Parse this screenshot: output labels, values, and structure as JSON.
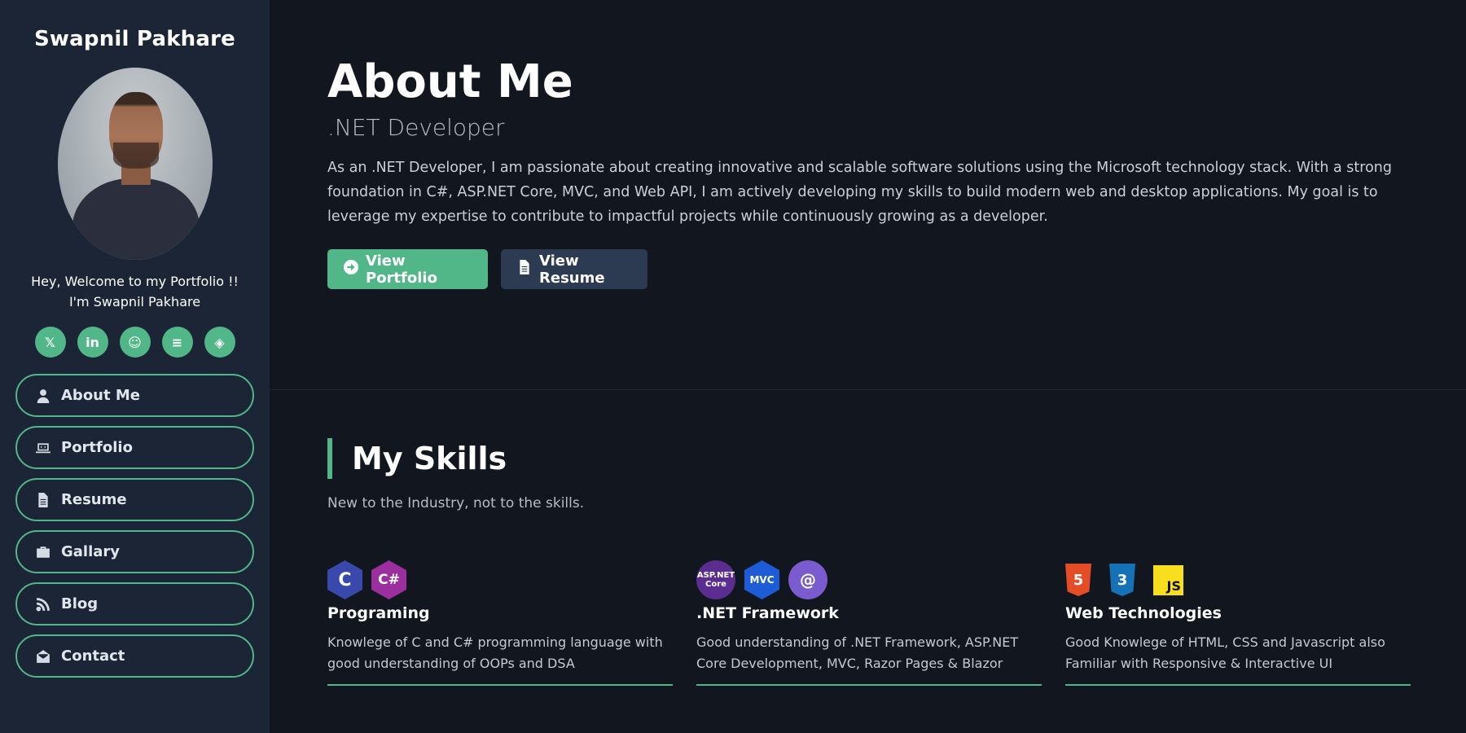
{
  "sidebar": {
    "name": "Swapnil Pakhare",
    "welcome_line1": "Hey, Welcome to my Portfolio !!",
    "welcome_line2": "I'm Swapnil Pakhare",
    "social": [
      {
        "icon": "x-twitter-icon",
        "glyph": "𝕏"
      },
      {
        "icon": "linkedin-icon",
        "glyph": "in"
      },
      {
        "icon": "github-icon",
        "glyph": "☺"
      },
      {
        "icon": "stack-overflow-icon",
        "glyph": "≡"
      },
      {
        "icon": "codepen-icon",
        "glyph": "◈"
      }
    ],
    "nav": [
      {
        "label": "About Me",
        "icon": "user-icon"
      },
      {
        "label": "Portfolio",
        "icon": "laptop-code-icon"
      },
      {
        "label": "Resume",
        "icon": "file-icon"
      },
      {
        "label": "Gallary",
        "icon": "briefcase-icon"
      },
      {
        "label": "Blog",
        "icon": "blog-icon"
      },
      {
        "label": "Contact",
        "icon": "envelope-open-icon"
      }
    ]
  },
  "about": {
    "title": "About Me",
    "subtitle": ".NET Developer",
    "description": "As an .NET Developer, I am passionate about creating innovative and scalable software solutions using the Microsoft technology stack. With a strong foundation in C#, ASP.NET Core, MVC, and Web API, I am actively developing my skills to build modern web and desktop applications. My goal is to leverage my expertise to contribute to impactful projects while continuously growing as a developer.",
    "buttons": {
      "portfolio": "View Portfolio",
      "resume": "View Resume"
    }
  },
  "skills": {
    "title": "My Skills",
    "subtitle": "New to the Industry, not to the skills.",
    "cards": [
      {
        "title": "Programing",
        "description": "Knowlege of C and C# programming language with good understanding of OOPs and DSA",
        "icons": [
          {
            "label": "C"
          },
          {
            "label": "C#"
          }
        ]
      },
      {
        "title": ".NET Framework",
        "description": "Good understanding of .NET Framework, ASP.NET Core Development, MVC, Razor Pages & Blazor",
        "icons": [
          {
            "label": "ASP.NET Core"
          },
          {
            "label": "MVC"
          },
          {
            "label": "@"
          }
        ]
      },
      {
        "title": "Web Technologies",
        "description": "Good Knowlege of HTML, CSS and Javascript also Familiar with Responsive & Interactive UI",
        "icons": [
          {
            "label": "5"
          },
          {
            "label": "3"
          },
          {
            "label": "JS"
          }
        ]
      }
    ]
  },
  "colors": {
    "accent": "#52b788",
    "sidebar_bg": "#1c2535",
    "main_bg": "#12161f",
    "secondary_button": "#2d3b52"
  }
}
